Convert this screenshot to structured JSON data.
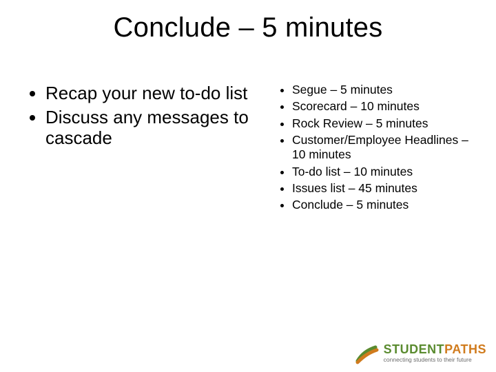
{
  "title": "Conclude – 5 minutes",
  "left_bullets": [
    "Recap your new to-do list",
    "Discuss any messages to cascade"
  ],
  "right_bullets": [
    "Segue – 5 minutes",
    "Scorecard – 10 minutes",
    "Rock Review – 5 minutes",
    "Customer/Employee Headlines – 10 minutes",
    "To-do list – 10 minutes",
    "Issues list – 45 minutes",
    "Conclude – 5 minutes"
  ],
  "logo": {
    "word1": "STUDENT",
    "word2": "PATHS",
    "tagline": "connecting students to their future"
  }
}
